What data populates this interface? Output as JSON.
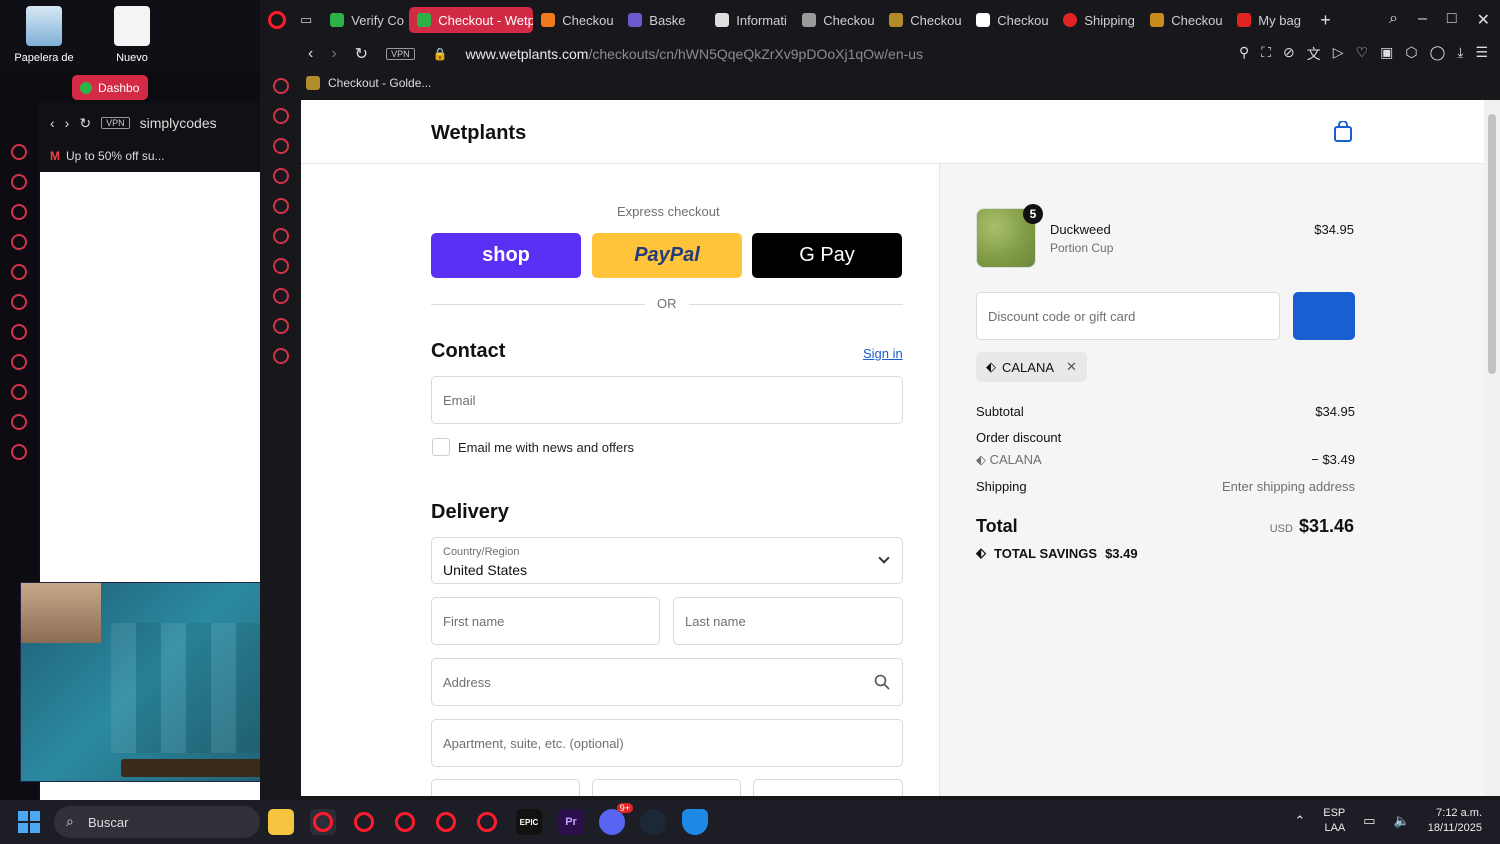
{
  "desktop": {
    "icons": [
      {
        "label": "Papelera de"
      },
      {
        "label": "Nuevo"
      }
    ]
  },
  "bg_window": {
    "active_tab": "Dashbo",
    "address": "simplycodes",
    "bookmark": "Up to 50% off su..."
  },
  "browser": {
    "tabs": [
      {
        "label": "Verify Co",
        "color": "#2bb34a"
      },
      {
        "label": "Checkout - Wetp",
        "color": "#2bb34a",
        "active": true
      },
      {
        "label": "Checkou",
        "color": "#f07a1c"
      },
      {
        "label": "Baske",
        "color": "#6a5acd"
      },
      {
        "label": "Informati",
        "color": "#dddddd"
      },
      {
        "label": "Checkou",
        "color": "#999999"
      },
      {
        "label": "Checkou",
        "color": "#b08d2a"
      },
      {
        "label": "Checkou",
        "color": "#ffffff"
      },
      {
        "label": "Shipping",
        "color": "#e02424"
      },
      {
        "label": "Checkou",
        "color": "#c98b1b"
      },
      {
        "label": "My bag",
        "color": "#e02424"
      }
    ],
    "vpn_label": "VPN",
    "url_domain": "www.wetplants.com",
    "url_path": "/checkouts/cn/hWN5QqeQkZrXv9pDOoXj1qOw/en-us",
    "bookmark": "Checkout - Golde..."
  },
  "page": {
    "brand": "Wetplants",
    "express_checkout": "Express checkout",
    "shop_label": "shop",
    "paypal_label": "PayPal",
    "gpay_label": "G Pay",
    "or_label": "OR",
    "contact_title": "Contact",
    "sign_in": "Sign in",
    "email_placeholder": "Email",
    "news_label": "Email me with news and offers",
    "delivery_title": "Delivery",
    "country_label": "Country/Region",
    "country_value": "United States",
    "first_name": "First name",
    "last_name": "Last name",
    "address": "Address",
    "apartment": "Apartment, suite, etc. (optional)"
  },
  "summary": {
    "product_name": "Duckweed",
    "product_variant": "Portion Cup",
    "quantity": "5",
    "product_price": "$34.95",
    "discount_placeholder": "Discount code or gift card",
    "applied_code": "CALANA",
    "subtotal_label": "Subtotal",
    "subtotal_value": "$34.95",
    "order_discount_label": "Order discount",
    "discount_code": "CALANA",
    "discount_value": "− $3.49",
    "shipping_label": "Shipping",
    "shipping_value": "Enter shipping address",
    "total_label": "Total",
    "currency": "USD",
    "total_value": "$31.46",
    "savings_label": "TOTAL SAVINGS",
    "savings_value": "$3.49",
    "accent_color": "#1a5fd1"
  },
  "taskbar": {
    "search_label": "Buscar",
    "language": "ESP",
    "layout": "LAA",
    "time": "7:12 a.m.",
    "date": "18/11/2025",
    "discord_badge": "9+"
  }
}
